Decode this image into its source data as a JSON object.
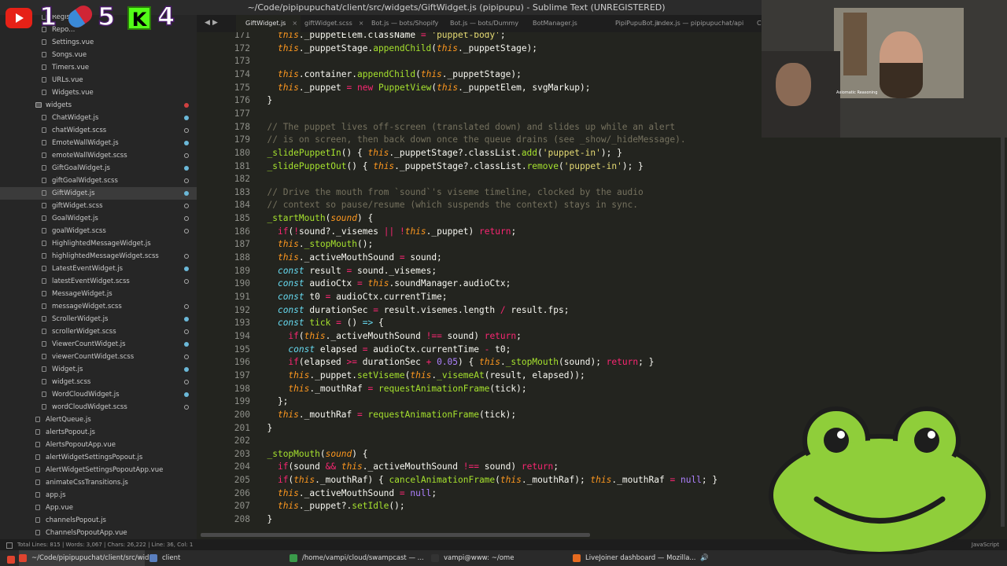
{
  "window": {
    "title": "~/Code/pipipupuchat/client/src/widgets/GiftWidget.js (pipipupu) - Sublime Text (UNREGISTERED)"
  },
  "overlay": {
    "counts": [
      "1",
      "5",
      "4"
    ],
    "kick_letter": "K"
  },
  "sidebar": {
    "items": [
      {
        "label": "Register...",
        "x": 66,
        "kind": "file",
        "dot": ""
      },
      {
        "label": "Repo...",
        "x": 66,
        "kind": "file",
        "dot": ""
      },
      {
        "label": "Settings.vue",
        "x": 66,
        "kind": "file",
        "dot": ""
      },
      {
        "label": "Songs.vue",
        "x": 66,
        "kind": "file",
        "dot": ""
      },
      {
        "label": "Timers.vue",
        "x": 66,
        "kind": "file",
        "dot": ""
      },
      {
        "label": "URLs.vue",
        "x": 66,
        "kind": "file",
        "dot": ""
      },
      {
        "label": "Widgets.vue",
        "x": 66,
        "kind": "file",
        "dot": ""
      },
      {
        "label": "widgets",
        "x": 58,
        "kind": "folder",
        "dot": "red"
      },
      {
        "label": "ChatWidget.js",
        "x": 66,
        "kind": "file",
        "dot": "mod"
      },
      {
        "label": "chatWidget.scss",
        "x": 66,
        "kind": "file",
        "dot": "new"
      },
      {
        "label": "EmoteWallWidget.js",
        "x": 66,
        "kind": "file",
        "dot": "mod"
      },
      {
        "label": "emoteWallWidget.scss",
        "x": 66,
        "kind": "file",
        "dot": "new"
      },
      {
        "label": "GiftGoalWidget.js",
        "x": 66,
        "kind": "file",
        "dot": "mod"
      },
      {
        "label": "giftGoalWidget.scss",
        "x": 66,
        "kind": "file",
        "dot": "new"
      },
      {
        "label": "GiftWidget.js",
        "x": 66,
        "kind": "file",
        "dot": "mod",
        "active": true
      },
      {
        "label": "giftWidget.scss",
        "x": 66,
        "kind": "file",
        "dot": "new"
      },
      {
        "label": "GoalWidget.js",
        "x": 66,
        "kind": "file",
        "dot": "new"
      },
      {
        "label": "goalWidget.scss",
        "x": 66,
        "kind": "file",
        "dot": "new"
      },
      {
        "label": "HighlightedMessageWidget.js",
        "x": 66,
        "kind": "file",
        "dot": ""
      },
      {
        "label": "highlightedMessageWidget.scss",
        "x": 66,
        "kind": "file",
        "dot": "new"
      },
      {
        "label": "LatestEventWidget.js",
        "x": 66,
        "kind": "file",
        "dot": "mod"
      },
      {
        "label": "latestEventWidget.scss",
        "x": 66,
        "kind": "file",
        "dot": "new"
      },
      {
        "label": "MessageWidget.js",
        "x": 66,
        "kind": "file",
        "dot": ""
      },
      {
        "label": "messageWidget.scss",
        "x": 66,
        "kind": "file",
        "dot": "new"
      },
      {
        "label": "ScrollerWidget.js",
        "x": 66,
        "kind": "file",
        "dot": "mod"
      },
      {
        "label": "scrollerWidget.scss",
        "x": 66,
        "kind": "file",
        "dot": "new"
      },
      {
        "label": "ViewerCountWidget.js",
        "x": 66,
        "kind": "file",
        "dot": "mod"
      },
      {
        "label": "viewerCountWidget.scss",
        "x": 66,
        "kind": "file",
        "dot": "new"
      },
      {
        "label": "Widget.js",
        "x": 66,
        "kind": "file",
        "dot": "mod"
      },
      {
        "label": "widget.scss",
        "x": 66,
        "kind": "file",
        "dot": "new"
      },
      {
        "label": "WordCloudWidget.js",
        "x": 66,
        "kind": "file",
        "dot": "mod"
      },
      {
        "label": "wordCloudWidget.scss",
        "x": 66,
        "kind": "file",
        "dot": "new"
      },
      {
        "label": "AlertQueue.js",
        "x": 58,
        "kind": "file",
        "dot": ""
      },
      {
        "label": "alertsPopout.js",
        "x": 58,
        "kind": "file",
        "dot": ""
      },
      {
        "label": "AlertsPopoutApp.vue",
        "x": 58,
        "kind": "file",
        "dot": ""
      },
      {
        "label": "alertWidgetSettingsPopout.js",
        "x": 58,
        "kind": "file",
        "dot": ""
      },
      {
        "label": "AlertWidgetSettingsPopoutApp.vue",
        "x": 58,
        "kind": "file",
        "dot": ""
      },
      {
        "label": "animateCssTransitions.js",
        "x": 58,
        "kind": "file",
        "dot": ""
      },
      {
        "label": "app.js",
        "x": 58,
        "kind": "file",
        "dot": ""
      },
      {
        "label": "App.vue",
        "x": 58,
        "kind": "file",
        "dot": ""
      },
      {
        "label": "channelsPopout.js",
        "x": 58,
        "kind": "file",
        "dot": ""
      },
      {
        "label": "ChannelsPopoutApp.vue",
        "x": 58,
        "kind": "file",
        "dot": ""
      }
    ]
  },
  "tabs": {
    "items": [
      {
        "label": "GiftWidget.js",
        "active": true,
        "close": "×"
      },
      {
        "label": "giftWidget.scss",
        "active": false,
        "close": "×"
      },
      {
        "label": "Bot.js — bots/Shopify",
        "active": false,
        "close": ""
      },
      {
        "label": "Bot.js — bots/Dummy",
        "active": false,
        "close": ""
      },
      {
        "label": "BotManager.js",
        "active": false,
        "close": ""
      },
      {
        "label": "PipiPupuBot.js",
        "active": false,
        "close": ""
      },
      {
        "label": "index.js — pipipupuchat/api",
        "active": false,
        "close": ""
      },
      {
        "label": "Ch",
        "active": false,
        "close": ""
      }
    ]
  },
  "editor": {
    "lines": [
      {
        "n": "171",
        "html": "    <span class=\"th\">this</span>._puppetElem.className <span class=\"kw\">=</span> <span class=\"st\">'puppet-body'</span>;"
      },
      {
        "n": "172",
        "html": "    <span class=\"th\">this</span>._puppetStage.<span class=\"fn\">appendChild</span>(<span class=\"th\">this</span>._puppetStage);"
      },
      {
        "n": "173",
        "html": ""
      },
      {
        "n": "174",
        "html": "    <span class=\"th\">this</span>.container.<span class=\"fn\">appendChild</span>(<span class=\"th\">this</span>._puppetStage);"
      },
      {
        "n": "175",
        "html": "    <span class=\"th\">this</span>._puppet <span class=\"kw\">=</span> <span class=\"kw\">new</span> <span class=\"fn\">PuppetView</span>(<span class=\"th\">this</span>._puppetElem, svgMarkup);"
      },
      {
        "n": "176",
        "html": "  }"
      },
      {
        "n": "177",
        "html": ""
      },
      {
        "n": "178",
        "html": "  <span class=\"cmt\">// The puppet lives off-screen (translated down) and slides up while an alert</span>"
      },
      {
        "n": "179",
        "html": "  <span class=\"cmt\">// is on screen, then back down once the queue drains (see _show/_hideMessage).</span>"
      },
      {
        "n": "180",
        "html": "  <span class=\"dec\">_slidePuppetIn</span>() { <span class=\"th\">this</span>._puppetStage?.classList.<span class=\"fn\">add</span>(<span class=\"st\">'puppet-in'</span>); }"
      },
      {
        "n": "181",
        "html": "  <span class=\"dec\">_slidePuppetOut</span>() { <span class=\"th\">this</span>._puppetStage?.classList.<span class=\"fn\">remove</span>(<span class=\"st\">'puppet-in'</span>); }"
      },
      {
        "n": "182",
        "html": ""
      },
      {
        "n": "183",
        "html": "  <span class=\"cmt\">// Drive the mouth from `sound`'s viseme timeline, clocked by the audio</span>"
      },
      {
        "n": "184",
        "html": "  <span class=\"cmt\">// context so pause/resume (which suspends the context) stays in sync.</span>"
      },
      {
        "n": "185",
        "html": "  <span class=\"dec\">_startMouth</span>(<span class=\"it\">sound</span>) {"
      },
      {
        "n": "186",
        "html": "    <span class=\"kw\">if</span>(<span class=\"kw\">!</span>sound?._visemes <span class=\"kw\">||</span> <span class=\"kw\">!</span><span class=\"th\">this</span>._puppet) <span class=\"kw\">return</span>;"
      },
      {
        "n": "187",
        "html": "    <span class=\"th\">this</span>.<span class=\"fn\">_stopMouth</span>();"
      },
      {
        "n": "188",
        "html": "    <span class=\"th\">this</span>._activeMouthSound <span class=\"kw\">=</span> sound;"
      },
      {
        "n": "189",
        "html": "    <span class=\"ty\">const</span> result <span class=\"kw\">=</span> sound._visemes;"
      },
      {
        "n": "190",
        "html": "    <span class=\"ty\">const</span> audioCtx <span class=\"kw\">=</span> <span class=\"th\">this</span>.soundManager.audioCtx;"
      },
      {
        "n": "191",
        "html": "    <span class=\"ty\">const</span> t0 <span class=\"kw\">=</span> audioCtx.currentTime;"
      },
      {
        "n": "192",
        "html": "    <span class=\"ty\">const</span> durationSec <span class=\"kw\">=</span> result.visemes.length <span class=\"kw\">/</span> result.fps;"
      },
      {
        "n": "193",
        "html": "    <span class=\"ty\">const</span> <span class=\"dec\">tick</span> <span class=\"kw\">=</span> () <span class=\"ty\">=&gt;</span> {"
      },
      {
        "n": "194",
        "html": "      <span class=\"kw\">if</span>(<span class=\"th\">this</span>._activeMouthSound <span class=\"kw\">!==</span> sound) <span class=\"kw\">return</span>;"
      },
      {
        "n": "195",
        "html": "      <span class=\"ty\">const</span> elapsed <span class=\"kw\">=</span> audioCtx.currentTime <span class=\"kw\">-</span> t0;"
      },
      {
        "n": "196",
        "html": "      <span class=\"kw\">if</span>(elapsed <span class=\"kw\">&gt;=</span> durationSec <span class=\"kw\">+</span> <span class=\"nu\">0.05</span>) { <span class=\"th\">this</span>.<span class=\"fn\">_stopMouth</span>(sound); <span class=\"kw\">return</span>; }"
      },
      {
        "n": "197",
        "html": "      <span class=\"th\">this</span>._puppet.<span class=\"fn\">setViseme</span>(<span class=\"th\">this</span>.<span class=\"fn\">_visemeAt</span>(result, elapsed));"
      },
      {
        "n": "198",
        "html": "      <span class=\"th\">this</span>._mouthRaf <span class=\"kw\">=</span> <span class=\"fn\">requestAnimationFrame</span>(tick);"
      },
      {
        "n": "199",
        "html": "    };"
      },
      {
        "n": "200",
        "html": "    <span class=\"th\">this</span>._mouthRaf <span class=\"kw\">=</span> <span class=\"fn\">requestAnimationFrame</span>(tick);"
      },
      {
        "n": "201",
        "html": "  }"
      },
      {
        "n": "202",
        "html": ""
      },
      {
        "n": "203",
        "html": "  <span class=\"dec\">_stopMouth</span>(<span class=\"it\">sound</span>) {"
      },
      {
        "n": "204",
        "html": "    <span class=\"kw\">if</span>(sound <span class=\"kw\">&amp;&amp;</span> <span class=\"th\">this</span>._activeMouthSound <span class=\"kw\">!==</span> sound) <span class=\"kw\">return</span>;"
      },
      {
        "n": "205",
        "html": "    <span class=\"kw\">if</span>(<span class=\"th\">this</span>._mouthRaf) { <span class=\"fn\">cancelAnimationFrame</span>(<span class=\"th\">this</span>._mouthRaf); <span class=\"th\">this</span>._mouthRaf <span class=\"kw\">=</span> <span class=\"nu\">null</span>; }"
      },
      {
        "n": "206",
        "html": "    <span class=\"th\">this</span>._activeMouthSound <span class=\"kw\">=</span> <span class=\"nu\">null</span>;"
      },
      {
        "n": "207",
        "html": "    <span class=\"th\">this</span>._puppet?.<span class=\"fn\">setIdle</span>();"
      },
      {
        "n": "208",
        "html": "  }"
      }
    ]
  },
  "statusbar": {
    "left": "Total Lines: 815 | Words: 3,067 | Chars: 26,222 | Line: 36, Col: 1",
    "right": "JavaScript"
  },
  "webcam": {
    "caption": "Axiomatic Reasoning"
  },
  "taskbar": {
    "items": [
      {
        "label": "~/Code/pipipupuchat/client/src/wid...",
        "active": true,
        "color": "#e0442f"
      },
      {
        "label": "client",
        "active": false,
        "color": "#5a7fbf"
      },
      {
        "label": "/home/vampi/cloud/swampcast — ...",
        "active": false,
        "color": "#3a9a4a"
      },
      {
        "label": "vampi@www: ~/ome",
        "active": false,
        "color": "#333"
      },
      {
        "label": "LiveJoiner dashboard — Mozilla...",
        "active": false,
        "color": "#e66a1f"
      }
    ]
  }
}
